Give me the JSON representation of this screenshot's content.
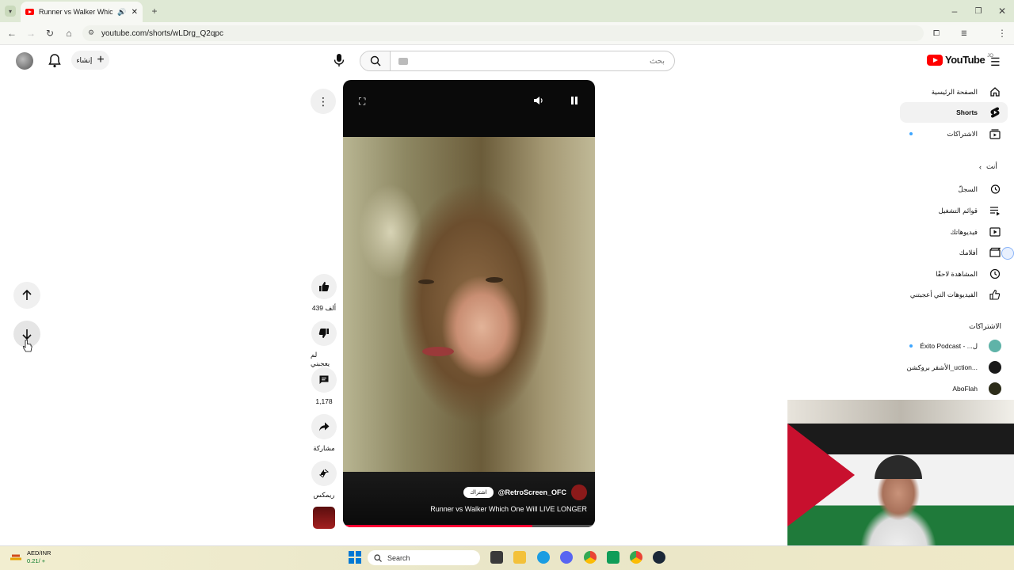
{
  "browser": {
    "tab_title": "Runner vs Walker Which O",
    "url": "youtube.com/shorts/wLDrg_Q2qpc"
  },
  "youtube": {
    "logo_text": "YouTube",
    "logo_badge": "JO",
    "search_placeholder": "بحث",
    "create_label": "إنشاء",
    "sidebar": {
      "items": [
        {
          "label": "الصفحة الرئيسية",
          "icon": "home-icon"
        },
        {
          "label": "Shorts",
          "icon": "shorts-icon"
        },
        {
          "label": "الاشتراكات",
          "icon": "subscriptions-icon"
        }
      ],
      "you_header": "أنت",
      "you_items": [
        {
          "label": "السجلّ",
          "icon": "history-icon"
        },
        {
          "label": "قوائم التشغيل",
          "icon": "playlists-icon"
        },
        {
          "label": "فيديوهاتك",
          "icon": "your-videos-icon"
        },
        {
          "label": "أفلامك",
          "icon": "movies-icon"
        },
        {
          "label": "المشاهدة لاحقًا",
          "icon": "watch-later-icon"
        },
        {
          "label": "الفيديوهات التي أعجبتني",
          "icon": "liked-icon"
        }
      ],
      "subs_header": "الاشتراكات",
      "subscriptions": [
        {
          "label": "Éxito Podcast - ...ل",
          "color": "#5fb3a8"
        },
        {
          "label": "الأشقر بروكشن_uction...",
          "color": "#1a1a1a"
        },
        {
          "label": "AboFlah",
          "color": "#2d2d1a"
        }
      ]
    },
    "short": {
      "channel": "@RetroScreen_OFC",
      "subscribe_label": "اشتراك",
      "title": "Runner vs Walker Which One Will LIVE LONGER",
      "progress": 0.75,
      "actions": {
        "likes": "439 ألف",
        "dislike_label": "لم يعجبني",
        "comments": "1,178",
        "share_label": "مشاركة",
        "remix_label": "ريمكس"
      }
    }
  },
  "taskbar": {
    "ticker_label": "AED/INR",
    "ticker_value": "0.21/ +",
    "search_label": "Search"
  },
  "colors": {
    "brand_red": "#ff0000",
    "progress_red": "#ff0033"
  }
}
